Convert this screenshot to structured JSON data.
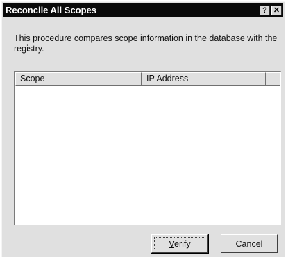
{
  "window": {
    "title": "Reconcile All Scopes",
    "help_glyph": "?",
    "close_glyph": "✕"
  },
  "description": "This procedure compares scope information in the database with the registry.",
  "list": {
    "columns": [
      "Scope",
      "IP Address"
    ],
    "rows": []
  },
  "buttons": {
    "verify": {
      "label_mnemonic": "V",
      "label_rest": "erify"
    },
    "cancel": "Cancel"
  },
  "colors": {
    "titlebar": "#0a0a0a",
    "dialog_face": "#e0e0e0",
    "list_background": "#ffffff"
  }
}
